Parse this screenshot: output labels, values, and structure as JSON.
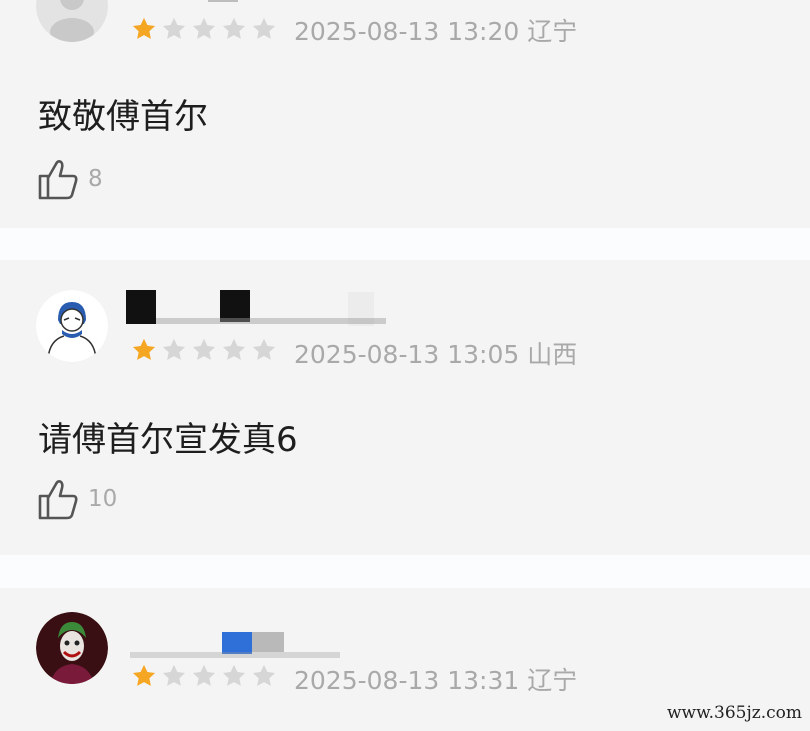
{
  "colors": {
    "card_bg": "#f4f4f4",
    "page_bg": "#fbfcfd",
    "star_filled": "#f5a623",
    "star_empty": "#d6d6d6",
    "meta_text": "#a9a9a9",
    "comment_text": "#1e1e1e"
  },
  "comments": [
    {
      "avatar_icon": "default-avatar-icon",
      "rating": 1,
      "max_rating": 5,
      "datetime": "2025-08-13 13:20",
      "location": "辽宁",
      "text": "致敬傅首尔",
      "likes": "8"
    },
    {
      "avatar_icon": "sketch-avatar-icon",
      "rating": 1,
      "max_rating": 5,
      "datetime": "2025-08-13 13:05",
      "location": "山西",
      "text": "请傅首尔宣发真6",
      "likes": "10"
    },
    {
      "avatar_icon": "joker-avatar-icon",
      "rating": 1,
      "max_rating": 5,
      "datetime": "2025-08-13 13:31",
      "location": "辽宁",
      "text": "",
      "likes": ""
    }
  ],
  "watermark": "www.365jz.com"
}
